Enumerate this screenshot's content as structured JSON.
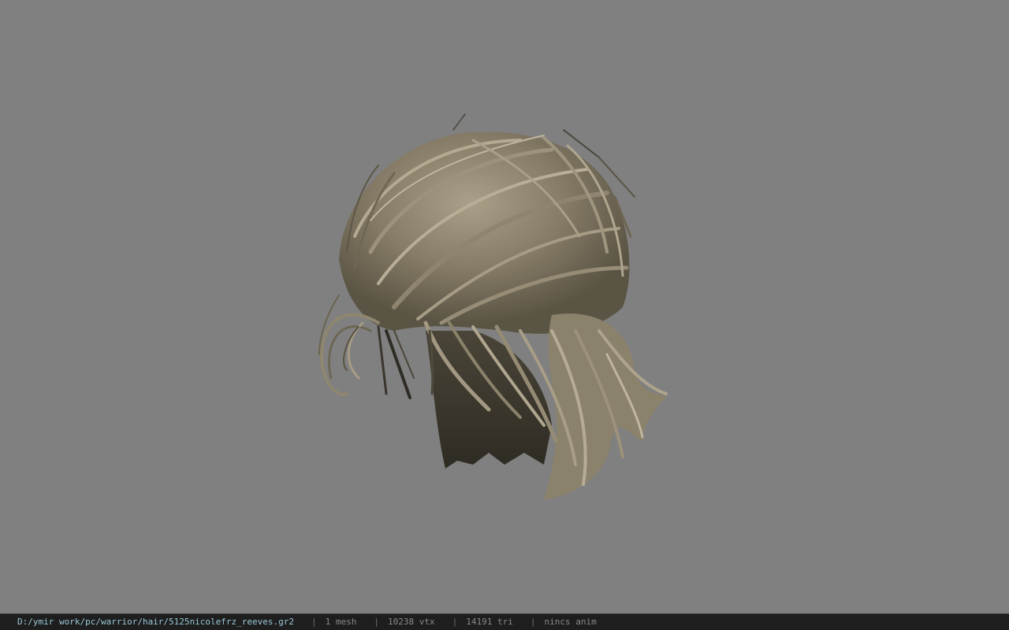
{
  "viewer": {
    "viewport": {
      "background_color": "#808080",
      "model_name": "hair mesh"
    },
    "statusbar": {
      "file_path": "D:/ymir work/pc/warrior/hair/5125nicolefrz_reeves.gr2",
      "separator": "|",
      "mesh_count": "1 mesh",
      "vertex_count": "10238 vtx",
      "triangle_count": "14191 tri",
      "anim_status": "nincs anim"
    },
    "colors": {
      "hair_light": "#a89e86",
      "hair_mid": "#7d735f",
      "hair_dark": "#3c382d",
      "statusbar_bg": "#1e1e1e",
      "path_text": "#9ac8d8"
    }
  }
}
